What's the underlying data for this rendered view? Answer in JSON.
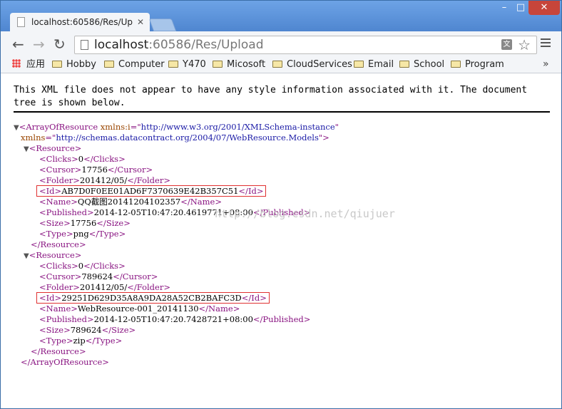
{
  "browser": {
    "tab_title": "localhost:60586/Res/Up",
    "url_host": "localhost",
    "url_rest": ":60586/Res/Upload",
    "window_controls": [
      "–",
      "□",
      "✕"
    ]
  },
  "bookmarks": {
    "apps_label": "应用",
    "folders": [
      "Hobby",
      "Computer",
      "Y470",
      "Micosoft",
      "CloudServices",
      "Email",
      "School",
      "Program"
    ],
    "more": "»"
  },
  "page": {
    "notice": "This XML file does not appear to have any style information associated with it. The document tree is shown below.",
    "watermark": "http://blog.csdn.net/qiujuer"
  },
  "xml": {
    "root_tag": "ArrayOfResource",
    "ns_i_attr": "xmlns:i",
    "ns_i_value": "http://www.w3.org/2001/XMLSchema-instance",
    "ns_attr": "xmlns",
    "ns_value": "http://schemas.datacontract.org/2004/07/WebResource.Models",
    "resource_tag": "Resource",
    "resources": [
      {
        "fields": [
          {
            "tag": "Clicks",
            "value": "0"
          },
          {
            "tag": "Cursor",
            "value": "17756"
          },
          {
            "tag": "Folder",
            "value": "201412/05/"
          },
          {
            "tag": "Id",
            "value": "AB7D0F0EE01AD6F7370639E42B357C51",
            "highlight": true
          },
          {
            "tag": "Name",
            "value": "QQ截图20141204102357"
          },
          {
            "tag": "Published",
            "value": "2014-12-05T10:47:20.4619771+08:00"
          },
          {
            "tag": "Size",
            "value": "17756"
          },
          {
            "tag": "Type",
            "value": "png"
          }
        ]
      },
      {
        "fields": [
          {
            "tag": "Clicks",
            "value": "0"
          },
          {
            "tag": "Cursor",
            "value": "789624"
          },
          {
            "tag": "Folder",
            "value": "201412/05/"
          },
          {
            "tag": "Id",
            "value": "29251D629D35A8A9DA28A52CB2BAFC3D",
            "highlight": true
          },
          {
            "tag": "Name",
            "value": "WebResource-001_20141130"
          },
          {
            "tag": "Published",
            "value": "2014-12-05T10:47:20.7428721+08:00"
          },
          {
            "tag": "Size",
            "value": "789624"
          },
          {
            "tag": "Type",
            "value": "zip"
          }
        ]
      }
    ]
  }
}
